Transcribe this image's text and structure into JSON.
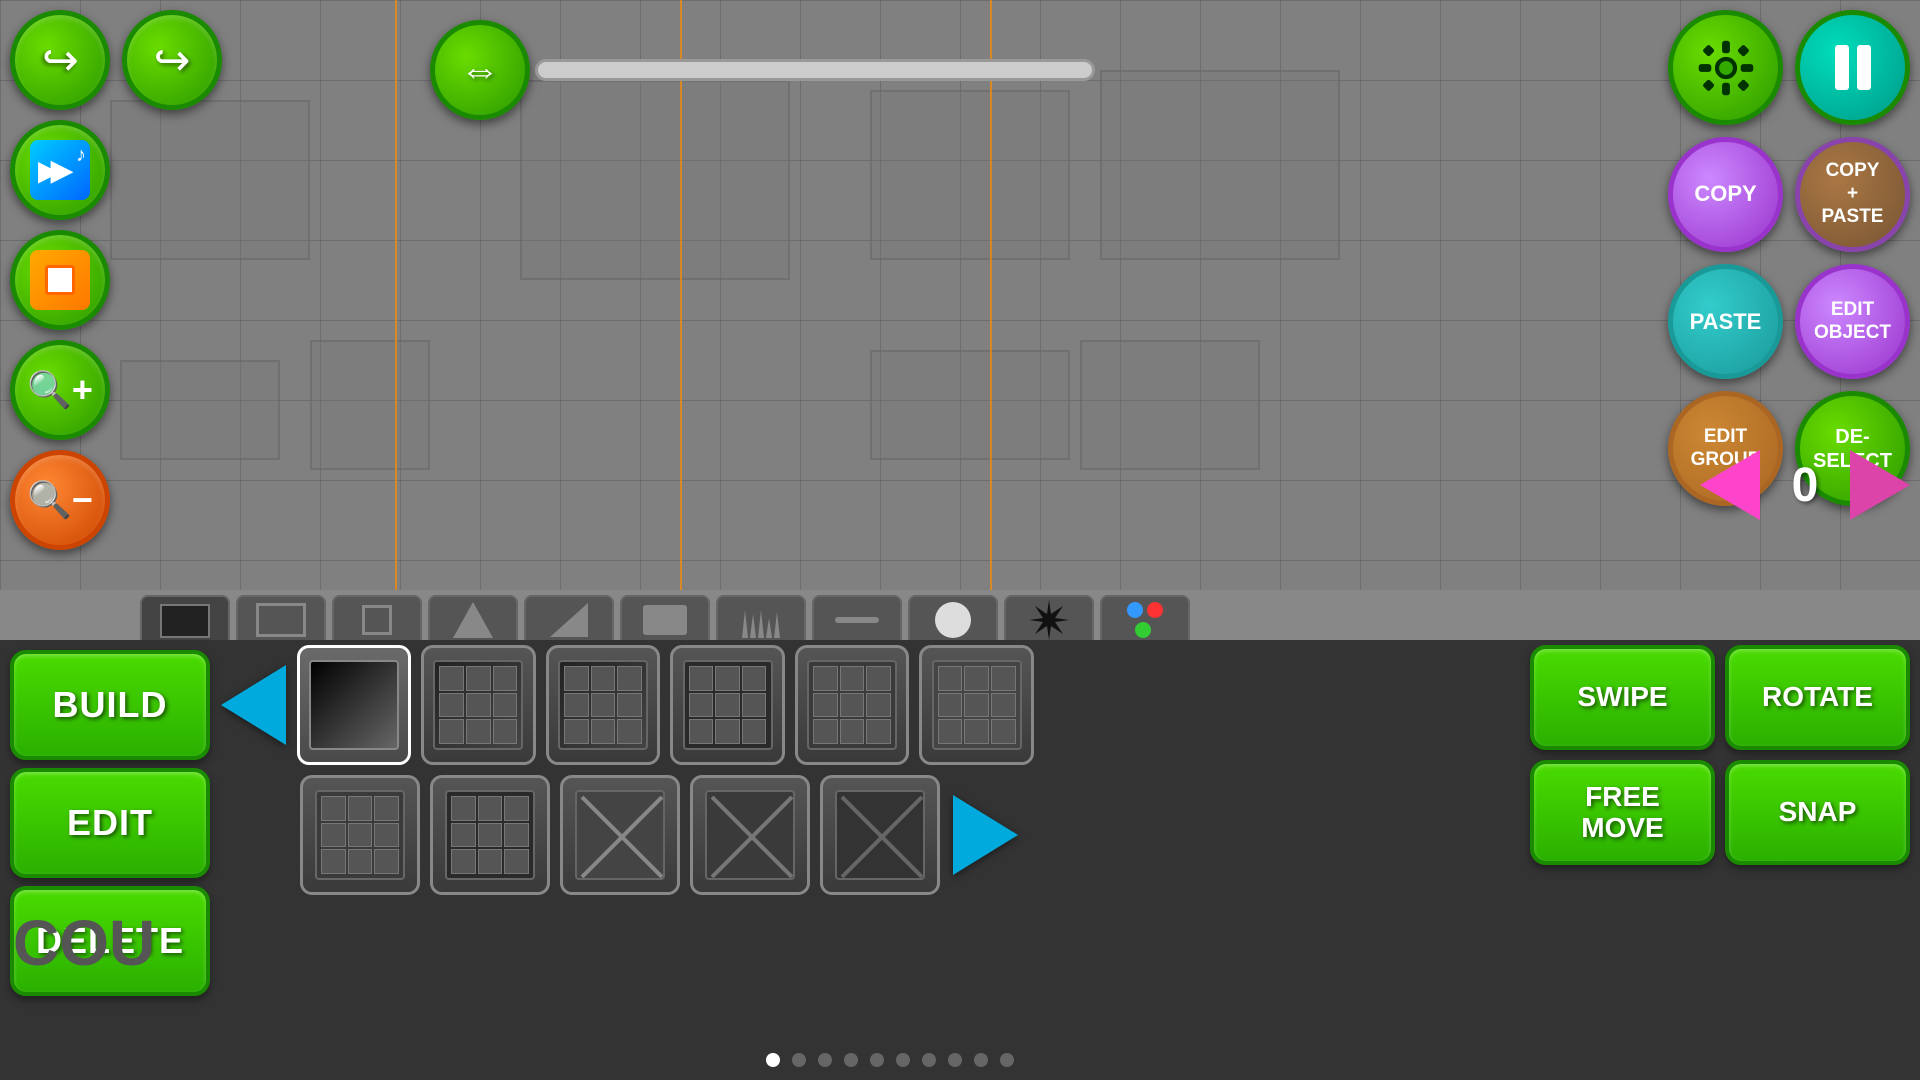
{
  "canvas": {
    "orange_lines": [
      395,
      680,
      990
    ]
  },
  "top_controls": {
    "undo_label": "↩",
    "redo_label": "↪",
    "scroll_arrows": "⟺",
    "page_number": "0"
  },
  "top_right": {
    "settings_label": "⚙",
    "pause_label": "⏸",
    "copy_label": "COPY",
    "copy_paste_label": "COPY\n+\nPASTE",
    "paste_label": "PASTE",
    "edit_object_label": "EDIT\nOBJECT",
    "edit_group_label": "EDIT\nGROUP",
    "deselect_label": "DE-\nSELECT"
  },
  "mode_buttons": {
    "build_label": "BUILD",
    "edit_label": "EDIT",
    "delete_label": "DELETE"
  },
  "action_buttons": {
    "swipe_label": "SWIPE",
    "rotate_label": "ROTATE",
    "free_move_label": "FREE\nMOVE",
    "snap_label": "SNAP"
  },
  "tabs": [
    {
      "id": "blocks",
      "active": true
    },
    {
      "id": "outlined"
    },
    {
      "id": "small"
    },
    {
      "id": "triangle"
    },
    {
      "id": "slope"
    },
    {
      "id": "item"
    },
    {
      "id": "spikes"
    },
    {
      "id": "dash"
    },
    {
      "id": "circle"
    },
    {
      "id": "burst"
    },
    {
      "id": "color"
    }
  ],
  "page_dots": [
    {
      "active": true
    },
    {
      "active": false
    },
    {
      "active": false
    },
    {
      "active": false
    },
    {
      "active": false
    },
    {
      "active": false
    },
    {
      "active": false
    },
    {
      "active": false
    },
    {
      "active": false
    },
    {
      "active": false
    }
  ],
  "cou_text": "COU"
}
